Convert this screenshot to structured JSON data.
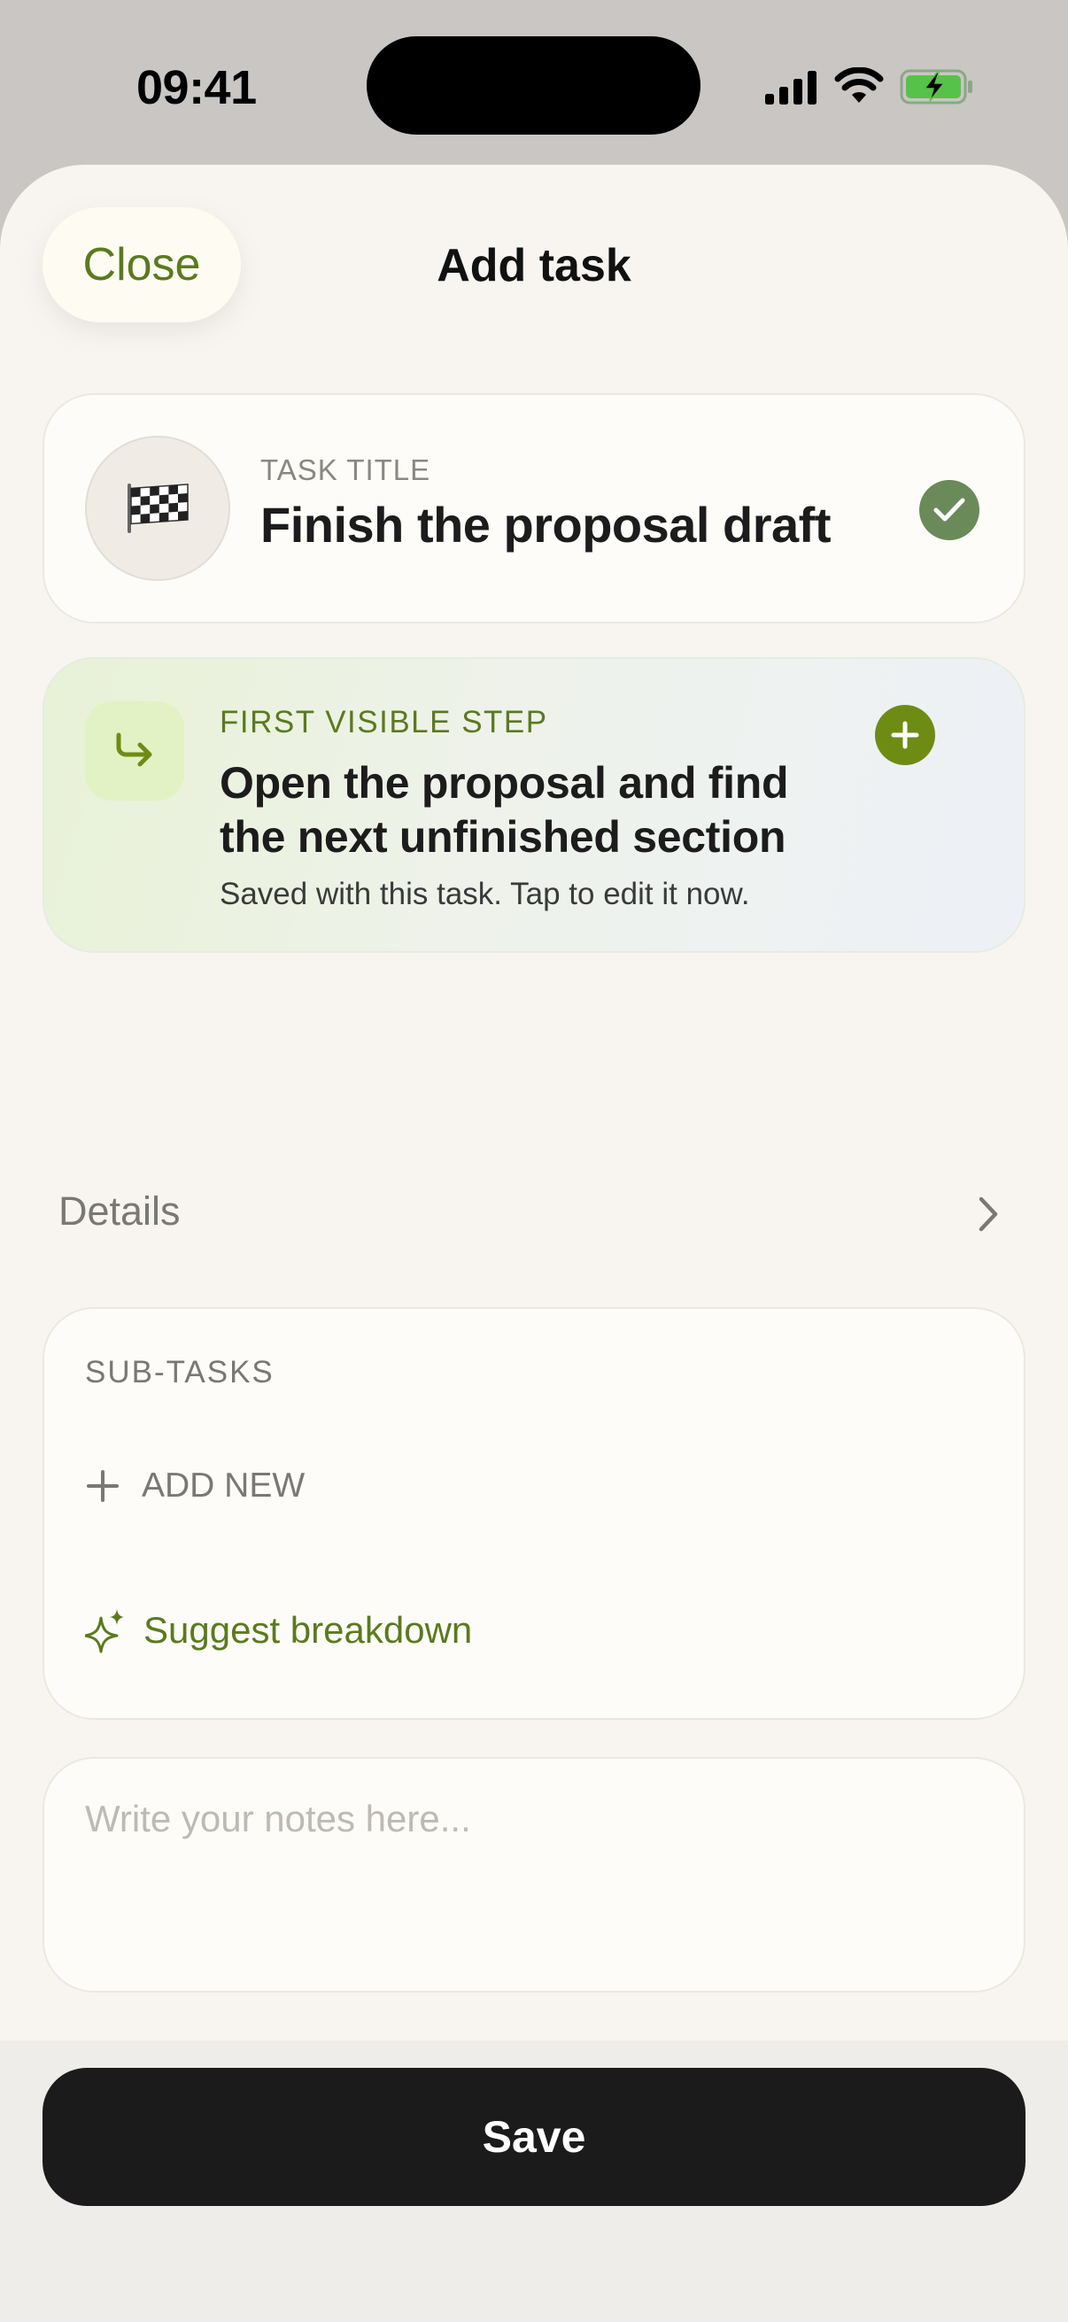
{
  "status_bar": {
    "time": "09:41",
    "icons": [
      "cellular-signal-icon",
      "wifi-icon",
      "battery-charging-icon"
    ]
  },
  "header": {
    "close_label": "Close",
    "title": "Add task"
  },
  "task": {
    "emoji": "🏁",
    "title_label": "TASK TITLE",
    "title_value": "Finish the proposal draft",
    "title_confirmed": true
  },
  "first_step": {
    "label": "FIRST VISIBLE STEP",
    "value": "Open the proposal and find the next unfinished section",
    "subtitle": "Saved with this task. Tap to edit it now.",
    "icon": "arrow-turn-down-right-icon"
  },
  "details": {
    "label": "Details"
  },
  "subtasks": {
    "label": "SUB-TASKS",
    "add_new_label": "ADD NEW",
    "suggest_label": "Suggest breakdown"
  },
  "notes": {
    "placeholder": "Write your notes here...",
    "value": ""
  },
  "footer": {
    "save_label": "Save"
  },
  "colors": {
    "accent_green": "#5b7a1e",
    "check_green": "#6b8a5a",
    "add_green": "#6e8c14",
    "save_button": "#1b1b1b",
    "sheet_background": "#f8f5f0"
  }
}
